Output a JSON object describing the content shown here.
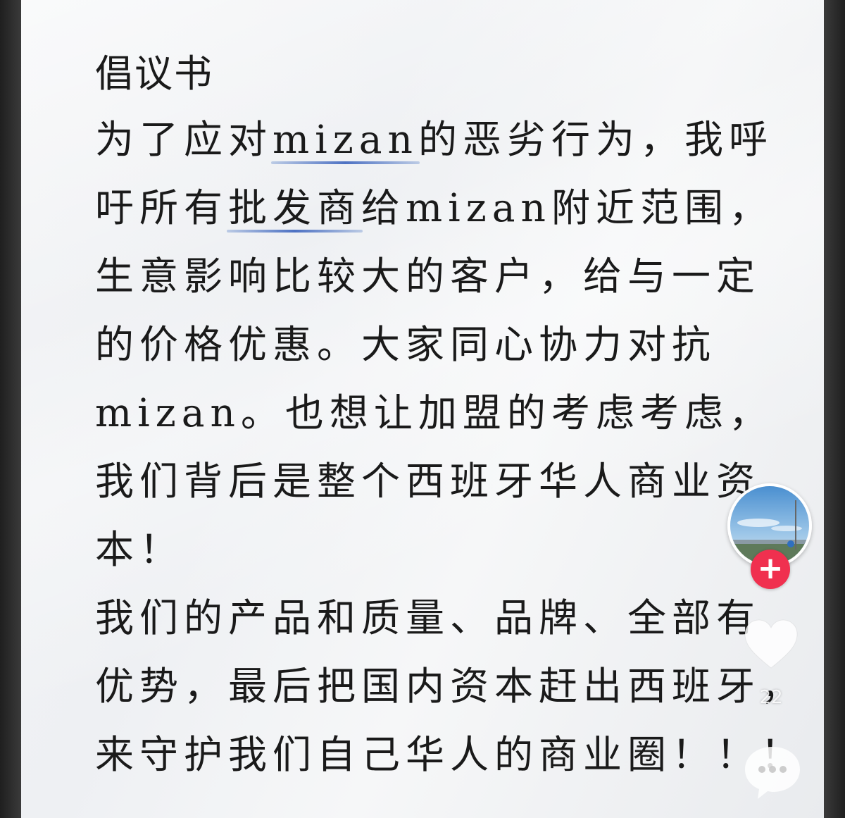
{
  "post": {
    "title": "倡议书",
    "lines": [
      {
        "before": "为了应对",
        "highlight": "mizan",
        "after": "的恶劣行为，我呼"
      },
      {
        "before": "吁所有",
        "highlight": "批发商",
        "after": "给mizan附近范围，"
      },
      {
        "text": "生意影响比较大的客户，给与一定"
      },
      {
        "text": "的价格优惠。大家同心协力对抗"
      },
      {
        "text": "mizan。也想让加盟的考虑考虑，"
      },
      {
        "text": "我们背后是整个西班牙华人商业资"
      },
      {
        "text": "本！"
      },
      {
        "text": "我们的产品和质量、品牌、全部有"
      },
      {
        "text": "优势，最后把国内资本赶出西班牙，"
      },
      {
        "text": "来守护我们自己华人的商业圈！！！"
      }
    ]
  },
  "sidebar": {
    "follow_label": "+",
    "like_count": "22",
    "icons": {
      "avatar": "avatar",
      "like": "heart-icon",
      "comment": "comment-icon"
    }
  },
  "colors": {
    "follow": "#f0304f",
    "highlight_underline": "#3c64be",
    "text": "#1a1a1a"
  }
}
